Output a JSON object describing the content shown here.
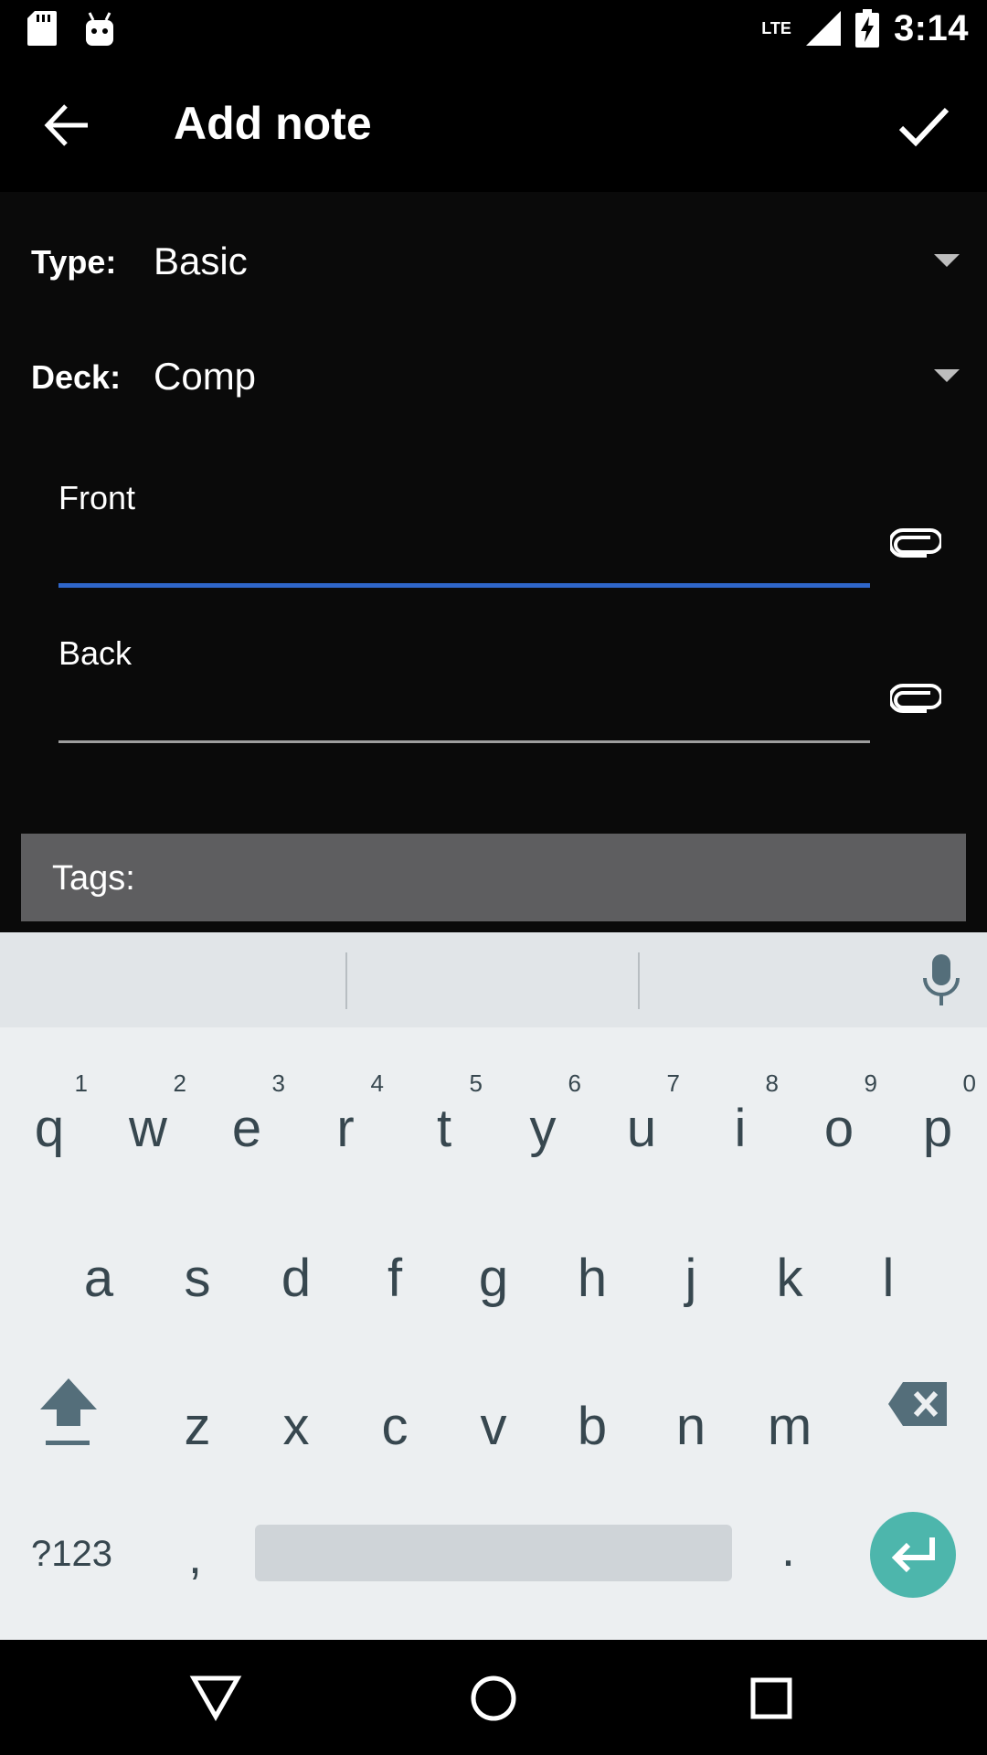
{
  "status_bar": {
    "time": "3:14",
    "network": "LTE",
    "icons": [
      "sd-card-icon",
      "android-icon",
      "signal-icon",
      "battery-charging-icon"
    ]
  },
  "toolbar": {
    "title": "Add note",
    "back_icon": "arrow-back-icon",
    "done_icon": "check-icon"
  },
  "form": {
    "type_label": "Type:",
    "type_value": "Basic",
    "deck_label": "Deck:",
    "deck_value": "Comp",
    "fields": [
      {
        "label": "Front",
        "value": ""
      },
      {
        "label": "Back",
        "value": ""
      }
    ],
    "tags_label": "Tags:"
  },
  "keyboard": {
    "row1": [
      "q",
      "w",
      "e",
      "r",
      "t",
      "y",
      "u",
      "i",
      "o",
      "p"
    ],
    "row1_hints": [
      "1",
      "2",
      "3",
      "4",
      "5",
      "6",
      "7",
      "8",
      "9",
      "0"
    ],
    "row2": [
      "a",
      "s",
      "d",
      "f",
      "g",
      "h",
      "j",
      "k",
      "l"
    ],
    "row3": [
      "z",
      "x",
      "c",
      "v",
      "b",
      "n",
      "m"
    ],
    "symbols_label": "?123",
    "comma": ",",
    "period": ".",
    "accent_color": "#4db6ac"
  },
  "colors": {
    "focus_underline": "#2f66c9",
    "tags_bar": "#5e5e60"
  }
}
